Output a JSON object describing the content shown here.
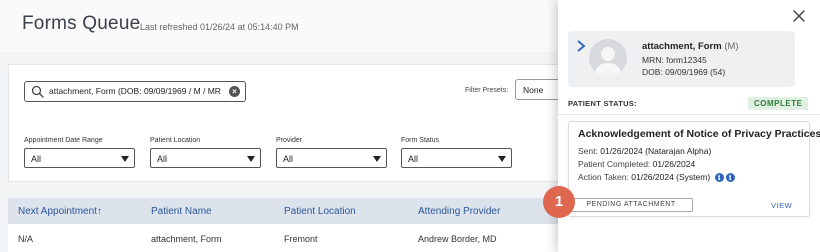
{
  "page": {
    "title": "Forms Queue",
    "last_refreshed": "Last refreshed 01/26/24 at 05:14:40 PM"
  },
  "filters": {
    "search_value": "attachment, Form (DOB: 09/09/1969 / M / MR",
    "filter_presets_label": "Filter Presets:",
    "filter_presets_value": "None",
    "dropdowns": [
      {
        "label": "Appointment Date Range",
        "value": "All"
      },
      {
        "label": "Patient Location",
        "value": "All"
      },
      {
        "label": "Provider",
        "value": "All"
      },
      {
        "label": "Form Status",
        "value": "All"
      }
    ]
  },
  "table": {
    "columns": [
      "Next Appointment",
      "Patient Name",
      "Patient Location",
      "Attending Provider"
    ],
    "sort_indicator": "↑",
    "rows": [
      [
        "N/A",
        "attachment, Form",
        "Fremont",
        "Andrew Border, MD"
      ]
    ]
  },
  "panel": {
    "patient": {
      "name": "attachment, Form",
      "sex": "(M)",
      "mrn": "MRN: form12345",
      "dob": "DOB: 09/09/1969 (54)"
    },
    "status_label": "PATIENT STATUS:",
    "status_value": "COMPLETE",
    "form": {
      "title": "Acknowledgement of Notice of Privacy Practices",
      "sent_label": "Sent:",
      "sent_value": "01/26/2024 (Natarajan Alpha)",
      "completed_label": "Patient Completed:",
      "completed_value": "01/26/2024",
      "action_label": "Action Taken:",
      "action_value": "01/26/2024 (System)",
      "pending_button": "PENDING ATTACHMENT",
      "view_link": "VIEW"
    }
  },
  "step_marker": "1",
  "colors": {
    "accent_blue": "#2a63b8",
    "header_text_blue": "#2b5797",
    "complete_green": "#2f7d3a",
    "step_marker": "#e0674f"
  },
  "icons": {
    "search": "search-icon",
    "clear": "clear-icon",
    "close": "close-icon",
    "chevron": "chevron-right-icon",
    "avatar": "avatar-icon",
    "info": "info-icon"
  }
}
